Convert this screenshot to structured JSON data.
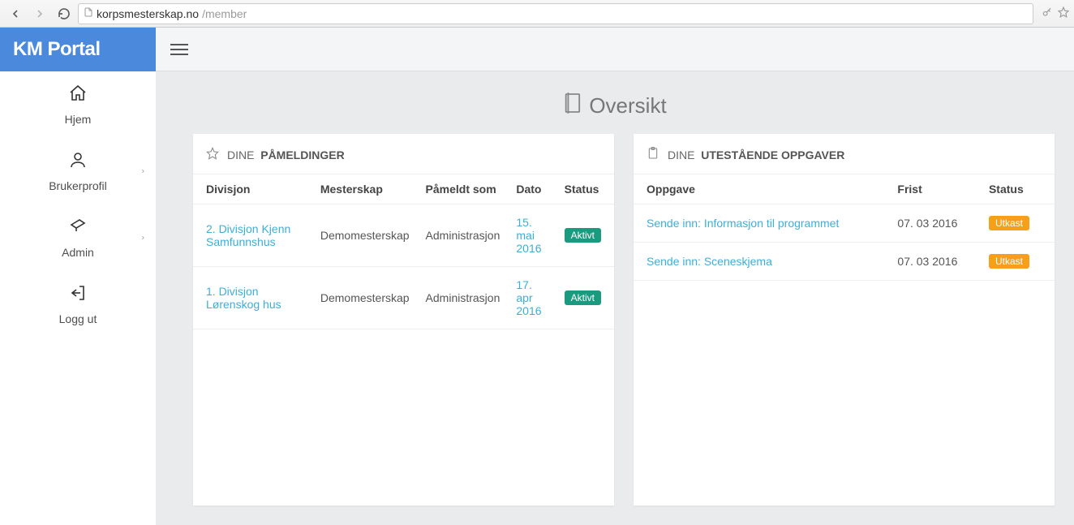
{
  "browser": {
    "url_host": "korpsmesterskap.no",
    "url_path": "/member"
  },
  "brand": "KM Portal",
  "sidebar": {
    "items": [
      {
        "label": "Hjem",
        "has_sub": false
      },
      {
        "label": "Brukerprofil",
        "has_sub": true
      },
      {
        "label": "Admin",
        "has_sub": true
      },
      {
        "label": "Logg ut",
        "has_sub": false
      }
    ]
  },
  "page": {
    "title": "Oversikt"
  },
  "registrations": {
    "title_light": "DINE",
    "title_bold": "PÅMELDINGER",
    "columns": {
      "division": "Divisjon",
      "championship": "Mesterskap",
      "registered_as": "Påmeldt som",
      "date": "Dato",
      "status": "Status"
    },
    "rows": [
      {
        "division": "2. Divisjon Kjenn Samfunnshus",
        "championship": "Demomesterskap",
        "registered_as": "Administrasjon",
        "date": "15. mai 2016",
        "status": "Aktivt"
      },
      {
        "division": "1. Divisjon Lørenskog hus",
        "championship": "Demomesterskap",
        "registered_as": "Administrasjon",
        "date": "17. apr 2016",
        "status": "Aktivt"
      }
    ]
  },
  "tasks": {
    "title_light": "DINE",
    "title_bold": "UTESTÅENDE OPPGAVER",
    "columns": {
      "task": "Oppgave",
      "deadline": "Frist",
      "status": "Status"
    },
    "rows": [
      {
        "task": "Sende inn: Informasjon til programmet",
        "deadline": "07. 03 2016",
        "status": "Utkast"
      },
      {
        "task": "Sende inn: Sceneskjema",
        "deadline": "07. 03 2016",
        "status": "Utkast"
      }
    ]
  }
}
